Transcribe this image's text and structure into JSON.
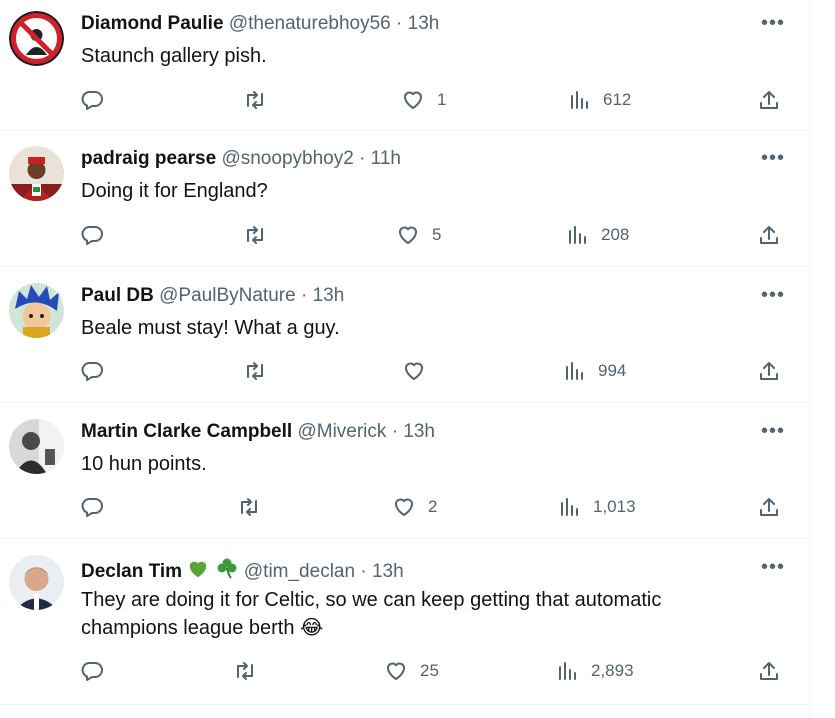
{
  "tweets": [
    {
      "name": "Diamond Paulie",
      "handle": "@thenaturebhoy56",
      "time": "13h",
      "text": "Staunch gallery pish.",
      "likes": "1",
      "views": "612"
    },
    {
      "name": "padraig pearse",
      "handle": "@snoopybhoy2",
      "time": "11h",
      "text": "Doing it for England?",
      "likes": "5",
      "views": "208"
    },
    {
      "name": "Paul DB",
      "handle": "@PaulByNature",
      "time": "13h",
      "text": "Beale must stay! What a guy.",
      "likes": "",
      "views": "994"
    },
    {
      "name": "Martin Clarke Campbell",
      "handle": "@Miverick",
      "time": "13h",
      "text": "10 hun points.",
      "likes": "2",
      "views": "1,013"
    },
    {
      "name": "Declan Tim",
      "handle": "@tim_declan",
      "time": "13h",
      "text_line1": "They are doing it for Celtic, so we can keep getting that automatic",
      "text_line2": "champions league berth 😂",
      "likes": "25",
      "views": "2,893"
    }
  ],
  "ui": {
    "dot": "·",
    "more": "•••"
  },
  "colors": {
    "icon": "#536471",
    "name": "#0f1419",
    "green_heart": "#5aa33a",
    "clover": "#3b9a3b"
  }
}
